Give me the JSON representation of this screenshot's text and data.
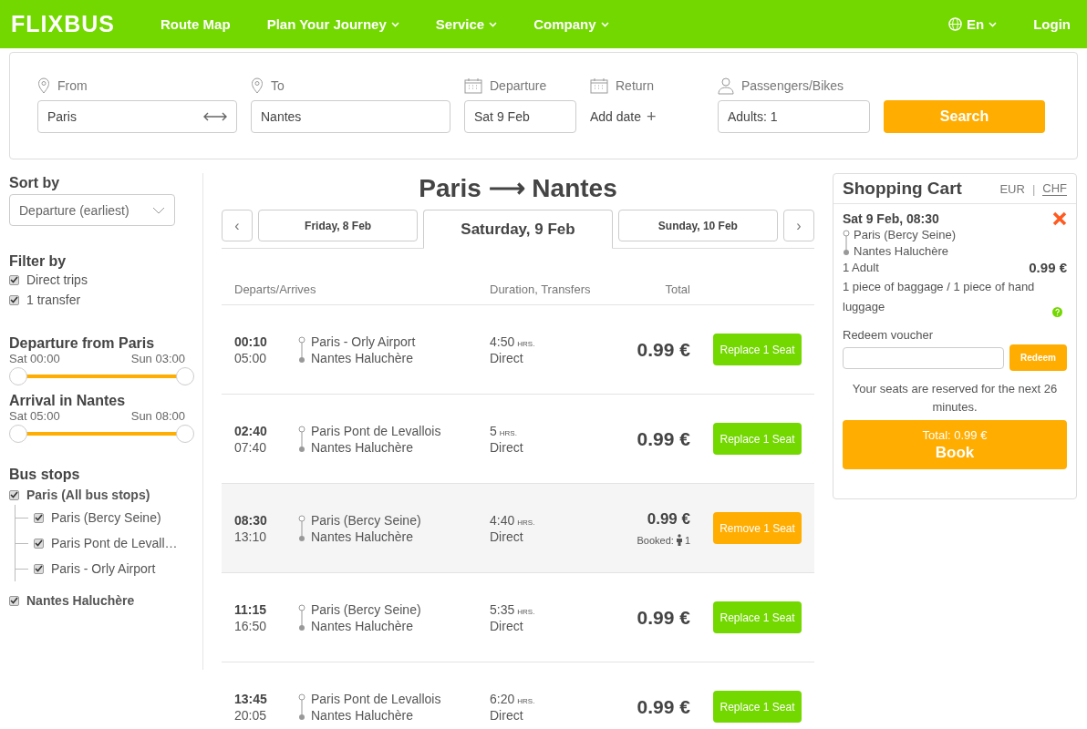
{
  "nav": {
    "logo": "FLIXBUS",
    "items": [
      {
        "label": "Route Map",
        "dropdown": false
      },
      {
        "label": "Plan Your Journey",
        "dropdown": true
      },
      {
        "label": "Service",
        "dropdown": true
      },
      {
        "label": "Company",
        "dropdown": true
      }
    ],
    "language": "En",
    "login": "Login"
  },
  "search": {
    "from": {
      "label": "From",
      "value": "Paris"
    },
    "to": {
      "label": "To",
      "value": "Nantes"
    },
    "departure": {
      "label": "Departure",
      "value": "Sat 9 Feb"
    },
    "return": {
      "label": "Return",
      "action": "Add date",
      "plus": "+"
    },
    "passengers": {
      "label": "Passengers/Bikes",
      "value": "Adults: 1"
    },
    "button": "Search"
  },
  "sidebar": {
    "sort": {
      "title": "Sort by",
      "value": "Departure (earliest)"
    },
    "filter": {
      "title": "Filter by",
      "options": [
        {
          "label": "Direct trips",
          "checked": true
        },
        {
          "label": "1 transfer",
          "checked": true
        }
      ]
    },
    "ranges": [
      {
        "title": "Departure from Paris",
        "start": "Sat 00:00",
        "end": "Sun 03:00",
        "thumbs": [
          {
            "level": 0
          },
          {
            "level": 1
          }
        ]
      },
      {
        "title": "Arrival in Nantes",
        "start": "Sat 05:00",
        "end": "Sun 08:00",
        "thumbs": [
          {
            "level": 0
          },
          {
            "level": 1
          }
        ]
      }
    ],
    "bus_stops": {
      "title": "Bus stops",
      "items": [
        {
          "label": "Paris (All bus stops)",
          "checked": true,
          "children": [
            {
              "label": "Paris (Bercy Seine)",
              "checked": true
            },
            {
              "label": "Paris Pont de Levall…",
              "checked": true
            },
            {
              "label": "Paris - Orly Airport",
              "checked": true
            }
          ]
        },
        {
          "label": "Nantes Haluchère",
          "checked": true
        }
      ]
    }
  },
  "results": {
    "title": "Paris ⟶ Nantes",
    "prev": "‹",
    "next": "›",
    "date_tabs": [
      {
        "label": "Friday, 8 Feb",
        "selected": false
      },
      {
        "label": "Saturday, 9 Feb",
        "selected": true
      },
      {
        "label": "Sunday, 10 Feb",
        "selected": false
      }
    ],
    "columns": [
      "Departs/Arrives",
      "Duration, Transfers",
      "Total"
    ],
    "trips": [
      {
        "depart": "00:10",
        "arrive": "05:00",
        "from": "Paris - Orly Airport",
        "to": "Nantes Haluchère",
        "duration": "4:50",
        "unit": "HRS.",
        "transfers": "Direct",
        "price": "0.99 €",
        "booked": false,
        "button": "Replace 1 Seat"
      },
      {
        "depart": "02:40",
        "arrive": "07:40",
        "from": "Paris Pont de Levallois",
        "to": "Nantes Haluchère",
        "duration": "5",
        "unit": "HRS.",
        "transfers": "Direct",
        "price": "0.99 €",
        "booked": false,
        "button": "Replace 1 Seat"
      },
      {
        "depart": "08:30",
        "arrive": "13:10",
        "from": "Paris (Bercy Seine)",
        "to": "Nantes Haluchère",
        "duration": "4:40",
        "unit": "HRS.",
        "transfers": "Direct",
        "price": "0.99 €",
        "booked": true,
        "booked_label": "Booked:",
        "booked_count": "1",
        "button": "Remove 1 Seat"
      },
      {
        "depart": "11:15",
        "arrive": "16:50",
        "from": "Paris (Bercy Seine)",
        "to": "Nantes Haluchère",
        "duration": "5:35",
        "unit": "HRS.",
        "transfers": "Direct",
        "price": "0.99 €",
        "booked": false,
        "button": "Replace 1 Seat"
      },
      {
        "depart": "13:45",
        "arrive": "20:05",
        "from": "Paris Pont de Levallois",
        "to": "Nantes Haluchère",
        "duration": "6:20",
        "unit": "HRS.",
        "transfers": "Direct",
        "price": "0.99 €",
        "booked": false,
        "button": "Replace 1 Seat"
      }
    ]
  },
  "cart": {
    "title": "Shopping Cart",
    "currencies": [
      {
        "label": "EUR",
        "selected": false
      },
      {
        "label": "CHF",
        "selected": true
      }
    ],
    "separator": "|",
    "trip": {
      "date": "Sat 9 Feb, 08:30",
      "from": "Paris (Bercy Seine)",
      "to": "Nantes Haluchère",
      "passenger": "1 Adult",
      "price": "0.99 €",
      "baggage": "1 piece of baggage / 1 piece of hand luggage"
    },
    "voucher": {
      "label": "Redeem voucher",
      "button": "Redeem"
    },
    "notice": "Your seats are reserved for the next 26 minutes.",
    "total": "Total: 0.99 €",
    "book": "Book"
  }
}
